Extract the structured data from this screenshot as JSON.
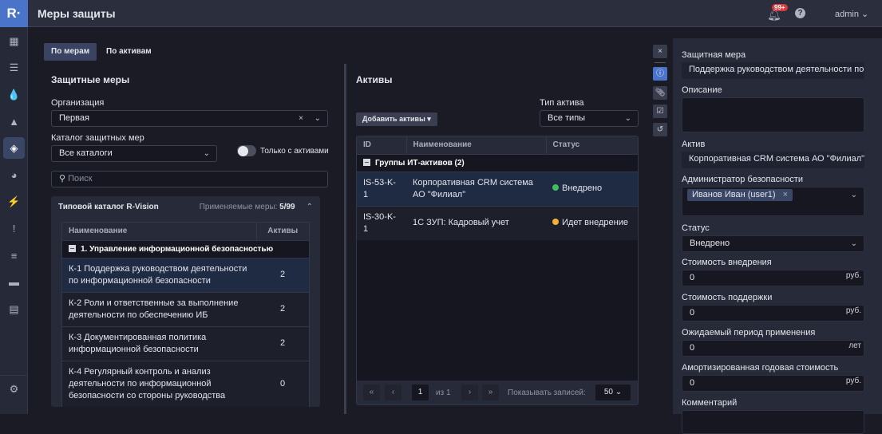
{
  "header": {
    "logo": "R·",
    "title": "Меры защиты",
    "notifications_badge": "99+",
    "user": "admin"
  },
  "sidebar": {
    "items": [
      {
        "icon": "grid-icon",
        "glyph": "▦"
      },
      {
        "icon": "database-icon",
        "glyph": "☰"
      },
      {
        "icon": "drop-icon",
        "glyph": "💧"
      },
      {
        "icon": "warning-icon",
        "glyph": "▲"
      },
      {
        "icon": "shield-icon",
        "glyph": "◈",
        "active": true
      },
      {
        "icon": "pie-chart-icon",
        "glyph": "◕"
      },
      {
        "icon": "lightning-icon",
        "glyph": "⚡"
      },
      {
        "icon": "alert-circle-icon",
        "glyph": "!"
      },
      {
        "icon": "list-icon",
        "glyph": "≡"
      },
      {
        "icon": "folder-icon",
        "glyph": "▬"
      },
      {
        "icon": "report-icon",
        "glyph": "▤"
      }
    ],
    "settings_glyph": "⚙",
    "expand_glyph": "›"
  },
  "tabs": [
    {
      "label": "По мерам",
      "active": true
    },
    {
      "label": "По активам"
    }
  ],
  "left": {
    "title": "Защитные меры",
    "org_label": "Организация",
    "org_value": "Первая",
    "catalog_label": "Каталог защитных мер",
    "catalog_value": "Все каталоги",
    "toggle_label": "Только с активами",
    "toggle_on": false,
    "search_placeholder": "Поиск",
    "catalog": {
      "name": "Типовой каталог R-Vision",
      "applied_label": "Применяемые меры:",
      "applied_value": "5/99",
      "columns": [
        "Наименование",
        "Активы"
      ],
      "group": "1. Управление информационной безопасностью",
      "rows": [
        {
          "name": "К-1 Поддержка руководством деятельности по информационной безопасности",
          "assets": "2",
          "selected": true
        },
        {
          "name": "К-2 Роли и ответственные за выполнение деятельности по обеспечению ИБ",
          "assets": "2"
        },
        {
          "name": "К-3 Документированная политика информационной безопасности",
          "assets": "2"
        },
        {
          "name": "К-4 Регулярный контроль и анализ деятельности по информационной безопасности со стороны руководства",
          "assets": "0"
        }
      ]
    }
  },
  "assets": {
    "title": "Активы",
    "add_button": "Добавить активы",
    "type_label": "Тип актива",
    "type_value": "Все типы",
    "columns": [
      "ID",
      "Наименование",
      "Статус"
    ],
    "group": "Группы ИТ-активов (2)",
    "rows": [
      {
        "id": "IS-53-K-1",
        "name": "Корпоративная CRM система АО \"Филиал\"",
        "status": "Внедрено",
        "status_color": "#3fbf5f",
        "selected": true
      },
      {
        "id": "IS-30-K-1",
        "name": "1С ЗУП: Кадровый учет",
        "status": "Идет внедрение",
        "status_color": "#f2b23a"
      }
    ],
    "pagination": {
      "page": "1",
      "of": "из 1",
      "page_size_label": "Показывать записей:",
      "page_size": "50"
    }
  },
  "details": {
    "measure_label": "Защитная мера",
    "measure_value": "Поддержка руководством деятельности по информационной безопасности",
    "description_label": "Описание",
    "description_value": "",
    "asset_label": "Актив",
    "asset_value": "Корпоративная CRM система АО \"Филиал\"",
    "admin_label": "Администратор безопасности",
    "admin_tag": "Иванов Иван (user1)",
    "status_label": "Статус",
    "status_value": "Внедрено",
    "impl_cost_label": "Стоимость внедрения",
    "impl_cost": "0",
    "support_cost_label": "Стоимость поддержки",
    "support_cost": "0",
    "period_label": "Ожидаемый период применения",
    "period": "0",
    "amort_label": "Амортизированная годовая стоимость",
    "amort": "0",
    "rub": "руб.",
    "years": "лет",
    "comment_label": "Комментарий"
  },
  "colors": {
    "accent": "#4a74c9",
    "bg": "#1b1b26",
    "panel": "#272a38"
  }
}
